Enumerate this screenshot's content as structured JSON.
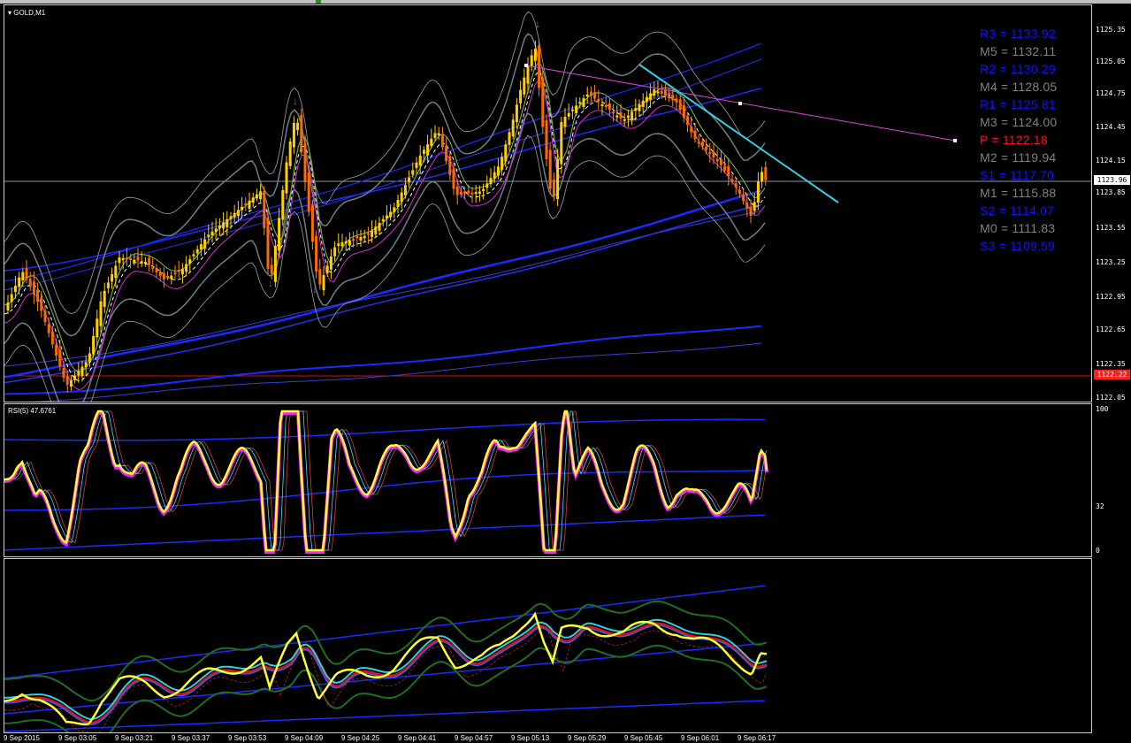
{
  "chart": {
    "title": "GOLD,M1",
    "current_price": "1123.96",
    "red_line_price": "1122.22",
    "price_labels": [
      "1125.35",
      "1125.05",
      "1124.75",
      "1124.45",
      "1124.15",
      "1123.85",
      "1123.55",
      "1123.25",
      "1122.95",
      "1122.65",
      "1122.35",
      "1122.05"
    ]
  },
  "pivots": [
    {
      "label": "R3 = 1133.92",
      "color": "#1010ff"
    },
    {
      "label": "M5 = 1132.11",
      "color": "#808080"
    },
    {
      "label": "R2 = 1130.29",
      "color": "#1010ff"
    },
    {
      "label": "M4 = 1128.05",
      "color": "#808080"
    },
    {
      "label": "R1 = 1125.81",
      "color": "#1010ff"
    },
    {
      "label": "M3 = 1124.00",
      "color": "#808080"
    },
    {
      "label": "P   = 1122.18",
      "color": "#ff1010"
    },
    {
      "label": "M2 = 1119.94",
      "color": "#808080"
    },
    {
      "label": "S1 = 1117.70",
      "color": "#1010ff"
    },
    {
      "label": "M1 = 1115.88",
      "color": "#808080"
    },
    {
      "label": "S2 = 1114.07",
      "color": "#1010ff"
    },
    {
      "label": "M0 = 1111.83",
      "color": "#808080"
    },
    {
      "label": "S3 = 1109.59",
      "color": "#1010ff"
    }
  ],
  "rsi": {
    "title": "RSI(5) 47.6761",
    "labels": [
      "100",
      "32",
      "0"
    ]
  },
  "time_axis": [
    "9 Sep 2015",
    "9 Sep 03:05",
    "9 Sep 03:21",
    "9 Sep 03:37",
    "9 Sep 03:53",
    "9 Sep 04:09",
    "9 Sep 04:25",
    "9 Sep 04:41",
    "9 Sep 04:57",
    "9 Sep 05:13",
    "9 Sep 05:29",
    "9 Sep 05:45",
    "9 Sep 06:01",
    "9 Sep 06:17"
  ]
}
